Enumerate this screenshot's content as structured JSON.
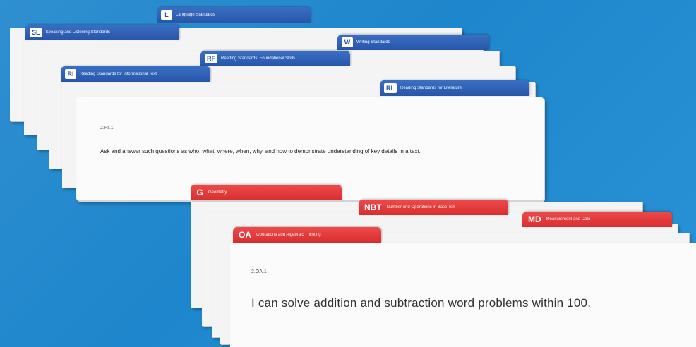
{
  "blue_deck": {
    "tabs": [
      {
        "abbr": "L",
        "title": "Language Standards"
      },
      {
        "abbr": "SL",
        "title": "Speaking and Listening Standards"
      },
      {
        "abbr": "W",
        "title": "Writing Standards"
      },
      {
        "abbr": "RF",
        "title": "Reading Standards: Foundational Skills"
      },
      {
        "abbr": "RI",
        "title": "Reading Standards for Informational Text"
      },
      {
        "abbr": "RL",
        "title": "Reading Standards for Literature"
      }
    ],
    "front_card": {
      "code": "2.RI.1",
      "text": "Ask and answer such questions as who, what, where, when, why, and how to demonstrate understanding of key details in a text."
    }
  },
  "red_deck": {
    "tabs": [
      {
        "abbr": "G",
        "title": "Geometry"
      },
      {
        "abbr": "NBT",
        "title": "Number and Operations in Base Ten"
      },
      {
        "abbr": "MD",
        "title": "Measurement and Data"
      },
      {
        "abbr": "OA",
        "title": "Operations and Algebraic Thinking"
      }
    ],
    "front_card": {
      "code": "2.OA.1",
      "text": "I can solve addition and subtraction word problems within 100."
    }
  },
  "colors": {
    "background": "#1e86cc",
    "blue_tab": "#2856a8",
    "red_tab": "#d92e2e",
    "card": "#fbfbfb"
  }
}
